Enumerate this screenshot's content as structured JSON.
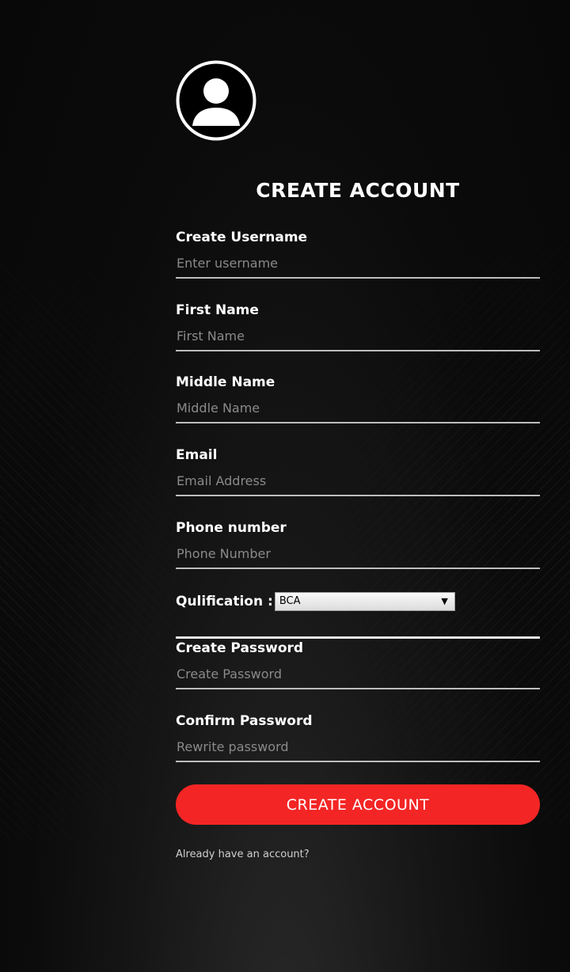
{
  "form": {
    "title": "CREATE ACCOUNT",
    "fields": [
      {
        "label": "Create Username",
        "placeholder": "Enter username"
      },
      {
        "label": "First Name",
        "placeholder": "First Name"
      },
      {
        "label": "Middle Name",
        "placeholder": "Middle Name"
      },
      {
        "label": "Email",
        "placeholder": "Email Address"
      },
      {
        "label": "Phone number",
        "placeholder": "Phone Number"
      },
      {
        "label": "Create Password",
        "placeholder": "Create Password"
      },
      {
        "label": "Confirm Password",
        "placeholder": "Rewrite password"
      }
    ],
    "qualification": {
      "label": "Qulification :",
      "selected": "BCA",
      "arrow": "▼"
    },
    "submit_label": "CREATE ACCOUNT",
    "signin_link": "Already have an account?"
  },
  "theme": {
    "background": "#0a0a0a",
    "accent": "#f42525",
    "text": "#ffffff",
    "placeholder": "#8a8a8a"
  },
  "icons": {
    "avatar": "user-avatar-icon",
    "dropdown": "chevron-down-icon"
  }
}
